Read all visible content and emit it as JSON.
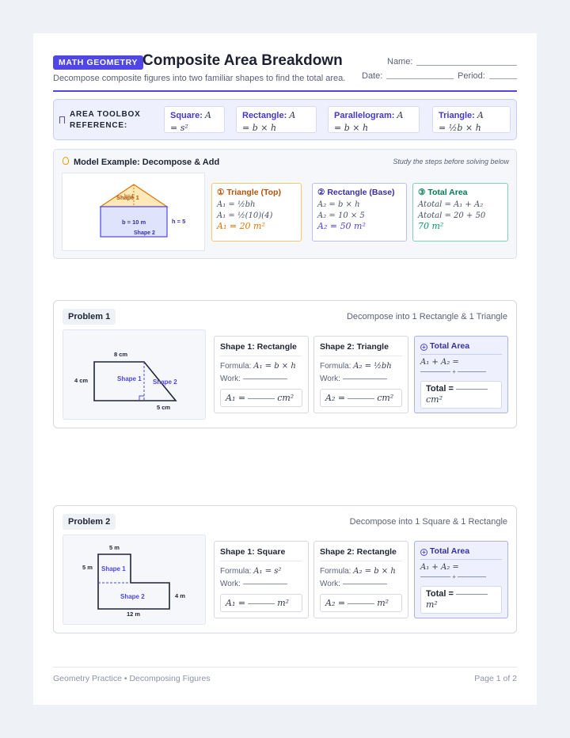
{
  "header": {
    "badge": "MATH GEOMETRY",
    "title": "Composite Area Breakdown",
    "subtitle": "Decompose composite figures into two familiar shapes to find the total area.",
    "name_label": "Name:",
    "date_label": "Date:",
    "period_label": "Period:"
  },
  "toolbox": {
    "title": "AREA TOOLBOX REFERENCE:",
    "items": [
      {
        "name": "Square:",
        "f1": "A",
        "f2": "= s²"
      },
      {
        "name": "Rectangle:",
        "f1": "A",
        "f2": "= b × h"
      },
      {
        "name": "Parallelogram:",
        "f1": "A",
        "f2": "= b × h"
      },
      {
        "name": "Triangle:",
        "f1": "A",
        "f2": "= ½b × h"
      }
    ]
  },
  "model": {
    "title": "Model Example: Decompose & Add",
    "note": "Study the steps before solving below",
    "figure": {
      "shape1": "Shape 1",
      "shape2": "Shape 2",
      "height_label": "h=4",
      "base_label": "b = 10 m",
      "rect_height_label": "h = 5"
    },
    "steps": [
      {
        "head": "① Triangle (Top)",
        "lines": [
          "A₁ = ½bh",
          "A₁ = ½(10)(4)"
        ],
        "result": "A₁ = 20 m²",
        "color": "#d97706"
      },
      {
        "head": "② Rectangle (Base)",
        "lines": [
          "A₂ = b × h",
          "A₂ = 10 × 5"
        ],
        "result": "A₂ = 50 m²",
        "color": "#4f46e5"
      },
      {
        "head": "③ Total Area",
        "lines": [
          "Atotal = A₁ + A₂",
          "Atotal = 20 + 50"
        ],
        "result": "70 m²",
        "color": "#059669"
      }
    ]
  },
  "problems": [
    {
      "tag": "Problem 1",
      "instruction": "Decompose into 1 Rectangle & 1 Triangle",
      "figure": {
        "top": "8 cm",
        "left": "4 cm",
        "bottom": "5 cm",
        "shape1": "Shape 1",
        "shape2": "Shape 2"
      },
      "card1": {
        "head": "Shape 1: Rectangle",
        "formula_label": "Formula:",
        "formula": "A₁ = b × h",
        "work_label": "Work:",
        "answer_lhs": "A₁ =",
        "unit": "cm²"
      },
      "card2": {
        "head": "Shape 2: Triangle",
        "formula_label": "Formula:",
        "formula": "A₂ = ½bh",
        "work_label": "Work:",
        "answer_lhs": "A₂ =",
        "unit": "cm²"
      },
      "total": {
        "head": "Total Area",
        "sum": "A₁ + A₂ =",
        "plus": "+",
        "label": "Total =",
        "unit": "cm²"
      }
    },
    {
      "tag": "Problem 2",
      "instruction": "Decompose into 1 Square & 1 Rectangle",
      "figure": {
        "top": "5 m",
        "left": "5 m",
        "right": "4 m",
        "bottom": "12 m",
        "shape1": "Shape 1",
        "shape2": "Shape 2"
      },
      "card1": {
        "head": "Shape 1: Square",
        "formula_label": "Formula:",
        "formula": "A₁ = s²",
        "work_label": "Work:",
        "answer_lhs": "A₁ =",
        "unit": "m²"
      },
      "card2": {
        "head": "Shape 2: Rectangle",
        "formula_label": "Formula:",
        "formula": "A₂ = b × h",
        "work_label": "Work:",
        "answer_lhs": "A₂ =",
        "unit": "m²"
      },
      "total": {
        "head": "Total Area",
        "sum": "A₁ + A₂ =",
        "plus": "+",
        "label": "Total =",
        "unit": "m²"
      }
    }
  ],
  "footer": {
    "left": "Geometry Practice • Decomposing Figures",
    "right": "Page 1 of 2"
  }
}
